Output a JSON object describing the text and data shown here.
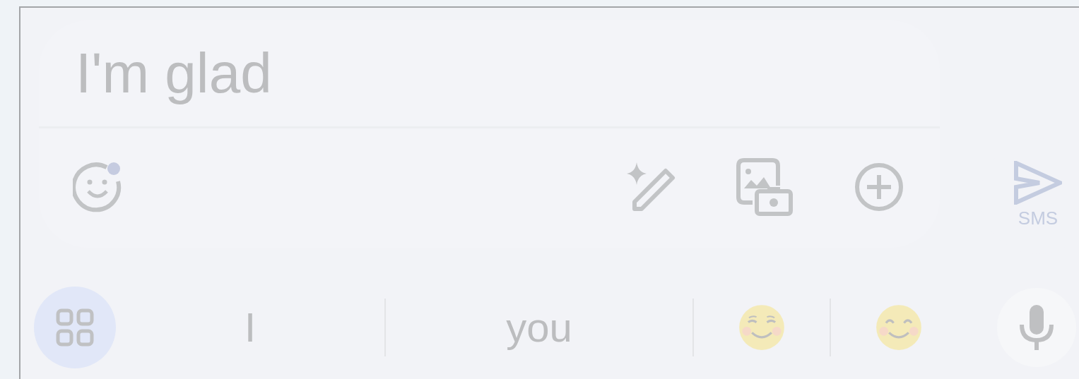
{
  "compose": {
    "value": "I'm glad",
    "send_label": "SMS"
  },
  "suggestions": [
    {
      "kind": "word",
      "text": "I"
    },
    {
      "kind": "word",
      "text": "you"
    },
    {
      "kind": "blush"
    },
    {
      "kind": "smile"
    }
  ]
}
